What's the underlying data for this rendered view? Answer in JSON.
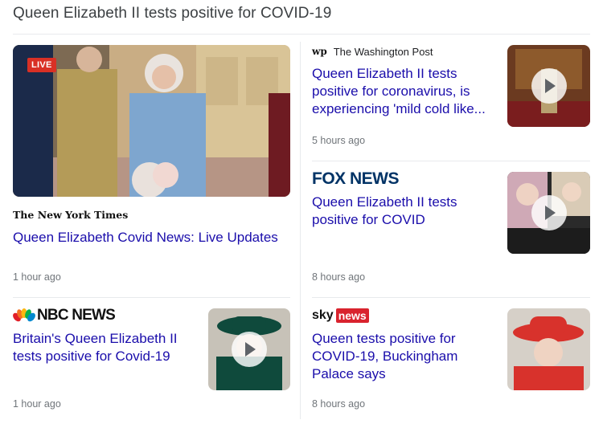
{
  "header": {
    "title": "Queen Elizabeth II tests positive for COVID-19"
  },
  "cards": {
    "nyt": {
      "live_badge": "LIVE",
      "source": "The New York Times",
      "headline": "Queen Elizabeth Covid News: Live Updates",
      "time": "1 hour ago"
    },
    "wapo": {
      "source_logo": "wp",
      "source": "The Washington Post",
      "headline": "Queen Elizabeth II tests positive for coronavirus, is experiencing 'mild cold like...",
      "time": "5 hours ago"
    },
    "fox": {
      "source": "FOX NEWS",
      "headline": "Queen Elizabeth II tests positive for COVID",
      "time": "8 hours ago"
    },
    "nbc": {
      "source": "NBC NEWS",
      "headline": "Britain's Queen Elizabeth II tests positive for Covid-19",
      "time": "1 hour ago"
    },
    "sky": {
      "source_sky": "sky",
      "source_news": "news",
      "headline": "Queen tests positive for COVID-19, Buckingham Palace says",
      "time": "8 hours ago"
    }
  },
  "colors": {
    "link": "#1a0dab",
    "meta": "#70757a",
    "live": "#d93025",
    "fox": "#003366",
    "sky_red": "#d9232e"
  },
  "icons": [
    "play-icon",
    "nbc-peacock-icon"
  ]
}
